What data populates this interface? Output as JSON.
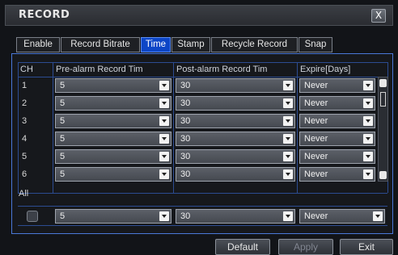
{
  "window": {
    "title": "RECORD",
    "close_label": "X"
  },
  "tabs": [
    {
      "label": "Enable",
      "active": false
    },
    {
      "label": "Record Bitrate",
      "active": false
    },
    {
      "label": "Time",
      "active": true
    },
    {
      "label": "Stamp",
      "active": false
    },
    {
      "label": "Recycle Record",
      "active": false
    },
    {
      "label": "Snap",
      "active": false
    }
  ],
  "table": {
    "headers": [
      "CH",
      "Pre-alarm Record Tim",
      "Post-alarm Record Tim",
      "Expire[Days]"
    ],
    "rows": [
      {
        "ch": "1",
        "pre": "5",
        "post": "30",
        "expire": "Never"
      },
      {
        "ch": "2",
        "pre": "5",
        "post": "30",
        "expire": "Never"
      },
      {
        "ch": "3",
        "pre": "5",
        "post": "30",
        "expire": "Never"
      },
      {
        "ch": "4",
        "pre": "5",
        "post": "30",
        "expire": "Never"
      },
      {
        "ch": "5",
        "pre": "5",
        "post": "30",
        "expire": "Never"
      },
      {
        "ch": "6",
        "pre": "5",
        "post": "30",
        "expire": "Never"
      }
    ]
  },
  "all": {
    "label": "All",
    "pre": "5",
    "post": "30",
    "expire": "Never"
  },
  "buttons": {
    "default": "Default",
    "apply": "Apply",
    "exit": "Exit"
  },
  "colors": {
    "active_tab": "#0d46c7",
    "panel_border": "#4a78d8",
    "background": "#121418"
  }
}
